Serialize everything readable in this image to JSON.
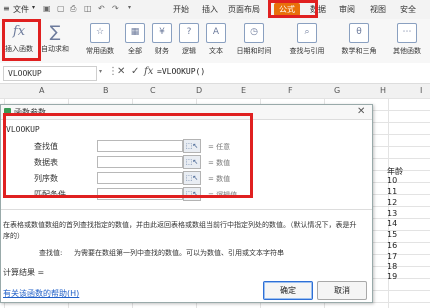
{
  "menu": {
    "file": "文件",
    "tabs": [
      "开始",
      "插入",
      "页面布局",
      "公式",
      "数据",
      "审阅",
      "视图",
      "安全"
    ],
    "active": "公式"
  },
  "ribbon": {
    "items": [
      "插入函数",
      "自动求和",
      "常用函数",
      "全部",
      "财务",
      "逻辑",
      "文本",
      "日期和时间",
      "查找与引用",
      "数学和三角",
      "其他函数"
    ],
    "insert_icon": "fx",
    "sum_icon": "∑"
  },
  "formula_bar": {
    "name_box": "VLOOKUP",
    "cancel": "✕",
    "confirm": "✓",
    "fx": "fx",
    "formula": "=VLOOKUP()"
  },
  "columns": [
    "A",
    "B",
    "C",
    "D",
    "E",
    "F",
    "G",
    "H",
    "I"
  ],
  "sheet": {
    "header": "年龄",
    "ages": [
      "10",
      "11",
      "12",
      "13",
      "14",
      "15",
      "16",
      "17",
      "18",
      "19"
    ]
  },
  "dialog": {
    "title": "函数参数",
    "close": "✕",
    "function_name": "VLOOKUP",
    "fields": [
      {
        "label": "查找值",
        "hint": "= 任意"
      },
      {
        "label": "数据表",
        "hint": "= 数值"
      },
      {
        "label": "列序数",
        "hint": "= 数值"
      },
      {
        "label": "匹配条件",
        "hint": "= 逻辑值"
      }
    ],
    "description": "在表格或数值数组的首列查找指定的数值，并由此返回表格或数组当前行中指定列处的数值。（默认情况下，表是升序的）",
    "param_name": "查找值:",
    "param_desc": "为需要在数组第一列中查找的数值。可以为数值、引用或文本字符串",
    "result": "计算结果 =",
    "help_link": "有关该函数的帮助(H)",
    "ok": "确定",
    "cancel": "取消"
  },
  "colors": {
    "accent": "#e8700a",
    "highlight": "#e02020",
    "primary_button": "#2f6fd6"
  }
}
